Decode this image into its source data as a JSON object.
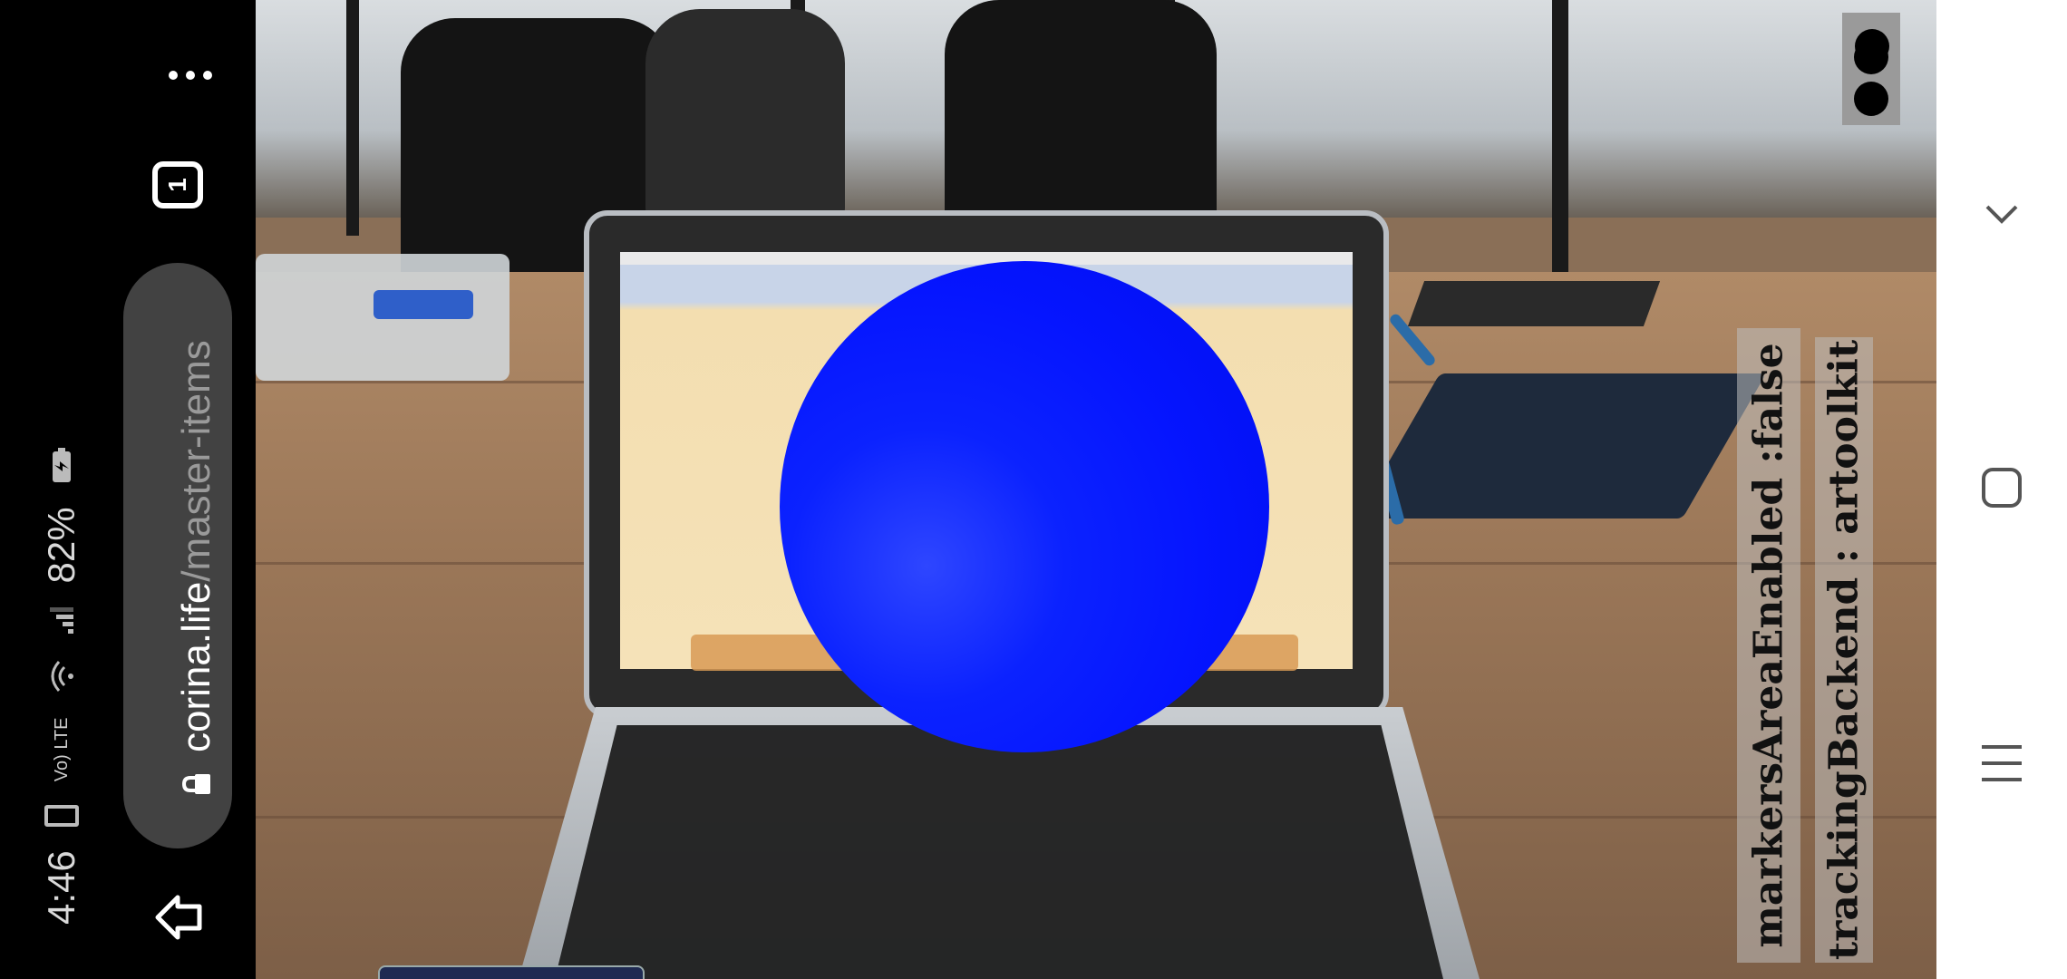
{
  "status_bar": {
    "time": "4:46",
    "network_type": "Vo) LTE",
    "battery_percent": "82%",
    "icons": [
      "phone-icon",
      "volte-icon",
      "wifi-icon",
      "signal-icon",
      "battery-charging-icon"
    ]
  },
  "browser": {
    "tab_count": "1",
    "url_domain": "corina.life",
    "url_path": "/master-items",
    "icons": [
      "more-options-icon",
      "tabs-icon",
      "lock-icon",
      "back-icon"
    ]
  },
  "ar_overlay": {
    "labels": [
      "markersAreaEnabled :false",
      "trackingBackend : artoolkit"
    ],
    "sphere_color": "#0a1cff"
  },
  "nav_bar": {
    "icons": [
      "collapse-chevron-icon",
      "home-square-icon",
      "recents-menu-icon"
    ]
  },
  "colors": {
    "browser_bg": "#000000",
    "url_pill": "#424242",
    "nav_bg": "#ffffff"
  }
}
